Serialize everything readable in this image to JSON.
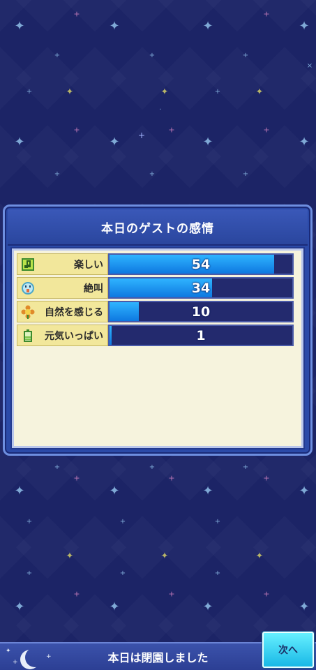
{
  "panel": {
    "title": "本日のゲストの感情"
  },
  "emotions": [
    {
      "label": "楽しい",
      "value": "54",
      "fill_percent": 90,
      "icon": "music-note-icon"
    },
    {
      "label": "絶叫",
      "value": "34",
      "fill_percent": 56,
      "icon": "screaming-face-icon"
    },
    {
      "label": "自然を感じる",
      "value": "10",
      "fill_percent": 16,
      "icon": "flower-icon"
    },
    {
      "label": "元気いっぱい",
      "value": "1",
      "fill_percent": 1,
      "icon": "battery-icon"
    }
  ],
  "footer": {
    "status": "本日は閉園しました",
    "next_label": "次へ"
  },
  "colors": {
    "bar_fill": "#1ea0f5",
    "label_bg": "#f2e79b",
    "panel": "#2b4aa8"
  }
}
